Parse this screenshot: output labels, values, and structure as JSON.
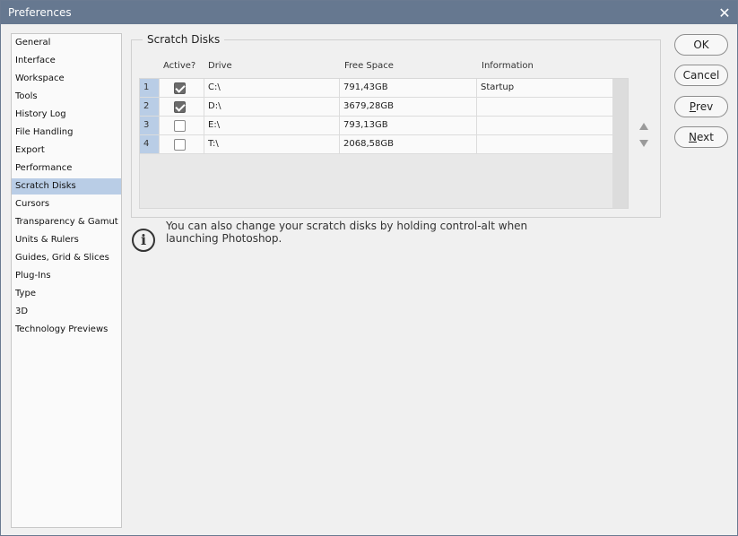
{
  "window": {
    "title": "Preferences",
    "close_glyph": "✕"
  },
  "sidebar": {
    "selected": "Scratch Disks",
    "items": [
      {
        "label": "General"
      },
      {
        "label": "Interface"
      },
      {
        "label": "Workspace"
      },
      {
        "label": "Tools"
      },
      {
        "label": "History Log"
      },
      {
        "label": "File Handling"
      },
      {
        "label": "Export"
      },
      {
        "label": "Performance"
      },
      {
        "label": "Scratch Disks"
      },
      {
        "label": "Cursors"
      },
      {
        "label": "Transparency & Gamut"
      },
      {
        "label": "Units & Rulers"
      },
      {
        "label": "Guides, Grid & Slices"
      },
      {
        "label": "Plug-Ins"
      },
      {
        "label": "Type"
      },
      {
        "label": "3D"
      },
      {
        "label": "Technology Previews"
      }
    ]
  },
  "scratch": {
    "group_label": "Scratch Disks",
    "columns": {
      "active": "Active?",
      "drive": "Drive",
      "free": "Free Space",
      "info": "Information"
    },
    "rows": [
      {
        "num": "1",
        "active": true,
        "drive": "C:\\",
        "free": "791,43GB",
        "info": "Startup"
      },
      {
        "num": "2",
        "active": true,
        "drive": "D:\\",
        "free": "3679,28GB",
        "info": ""
      },
      {
        "num": "3",
        "active": false,
        "drive": "E:\\",
        "free": "793,13GB",
        "info": ""
      },
      {
        "num": "4",
        "active": false,
        "drive": "T:\\",
        "free": "2068,58GB",
        "info": ""
      }
    ],
    "note": "You can also change your scratch disks by holding control-alt when launching Photoshop."
  },
  "buttons": {
    "ok": "OK",
    "cancel": "Cancel",
    "prev_first": "P",
    "prev_rest": "rev",
    "next_first": "N",
    "next_rest": "ext"
  },
  "colors": {
    "titlebar": "#667890",
    "selection": "#b9cde6"
  }
}
